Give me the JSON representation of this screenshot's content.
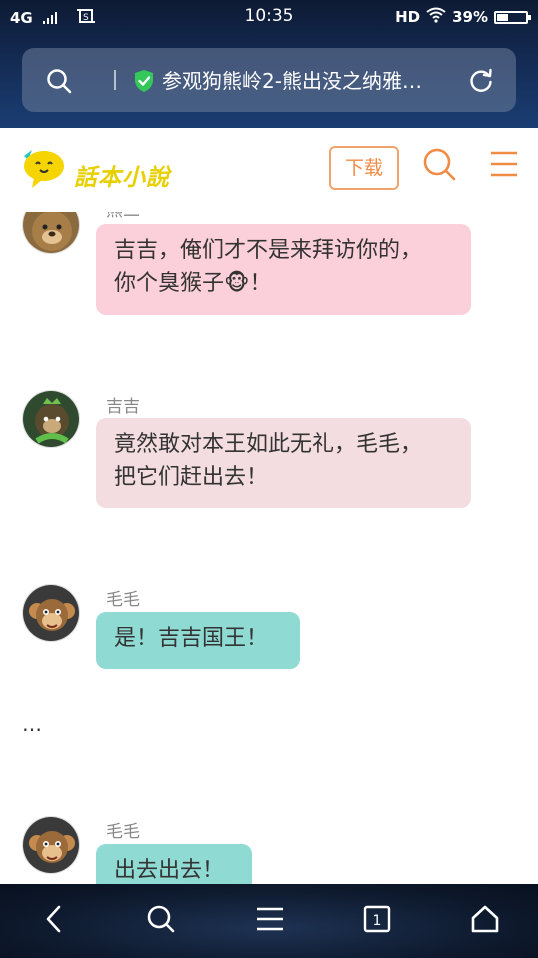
{
  "status_bar": {
    "network": "4G",
    "time": "10:35",
    "hd": "HD",
    "battery": "39%",
    "battery_level": 0.39
  },
  "url_bar": {
    "title": "参观狗熊岭2-熊出没之纳雅…"
  },
  "site_header": {
    "brand": "話本小說",
    "download_label": "下载"
  },
  "chat": {
    "messages": [
      {
        "speaker": "熊二",
        "text_line1": "吉吉，俺们才不是来拜访你的，",
        "text_line2": "你个臭猴子🐵！",
        "bubble_color": "#fcd0da"
      },
      {
        "speaker": "吉吉",
        "text_line1": "竟然敢对本王如此无礼，毛毛，",
        "text_line2": "把它们赶出去！",
        "bubble_color": "#f3dde0"
      },
      {
        "speaker": "毛毛",
        "text_line1": "是！吉吉国王！",
        "bubble_color": "#8fdbd4"
      },
      {
        "speaker": "毛毛",
        "text_line1": "出去出去！",
        "bubble_color": "#8fdbd4"
      }
    ],
    "ellipsis": "…"
  },
  "bottom_nav": {
    "tab_count": "1"
  },
  "colors": {
    "accent_orange": "#f08b45",
    "brand_yellow": "#e8d000"
  }
}
